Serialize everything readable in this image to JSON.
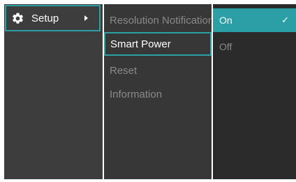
{
  "menu": {
    "setup_label": "Setup",
    "setup_icon": "gear-icon",
    "submenu_arrow_icon": "chevron-right-icon"
  },
  "submenu": {
    "items": [
      {
        "label": "Resolution Notification"
      },
      {
        "label": "Smart Power",
        "selected": true
      },
      {
        "label": "Reset"
      },
      {
        "label": "Information"
      }
    ]
  },
  "options": {
    "items": [
      {
        "label": "On",
        "active": true,
        "check": "✓"
      },
      {
        "label": "Off"
      }
    ]
  },
  "colors": {
    "accent": "#2aa0a4",
    "panel_left": "#3d3d3d",
    "panel_middle": "#373737",
    "panel_right": "#2a2a2a",
    "text_active": "#ffffff",
    "text_inactive": "#8a8a8a"
  }
}
